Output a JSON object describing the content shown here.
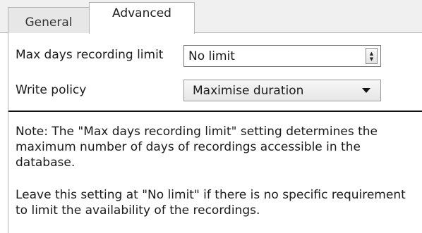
{
  "tabs": [
    {
      "label": "General",
      "active": false
    },
    {
      "label": "Advanced",
      "active": true
    }
  ],
  "fields": {
    "max_days": {
      "label": "Max days recording limit",
      "value": "No limit"
    },
    "write_policy": {
      "label": "Write policy",
      "value": "Maximise duration"
    }
  },
  "notes": {
    "paragraph1": "Note: The \"Max days recording limit\" setting determines the maximum number of days of recordings accessible in the database.",
    "paragraph2": "Leave this setting at \"No limit\" if there is no specific requirement to limit the availability of the recordings."
  },
  "icons": {
    "spin": "spin-up-down-icon",
    "dropdown": "chevron-down-icon"
  }
}
